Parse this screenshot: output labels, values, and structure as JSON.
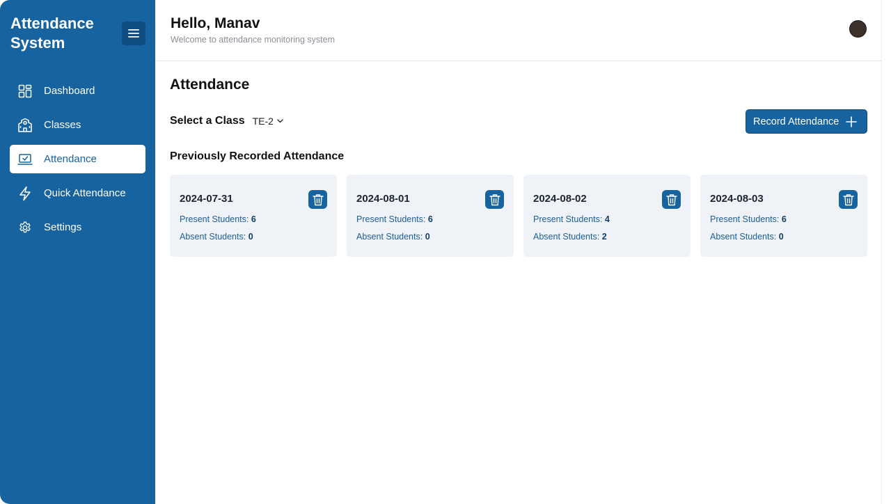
{
  "app": {
    "brand": "Attendance System"
  },
  "sidebar": {
    "items": [
      {
        "label": "Dashboard",
        "icon": "dashboard-grid-icon"
      },
      {
        "label": "Classes",
        "icon": "school-building-icon"
      },
      {
        "label": "Attendance",
        "icon": "attendance-laptop-check-icon",
        "active": true
      },
      {
        "label": "Quick Attendance",
        "icon": "lightning-icon"
      },
      {
        "label": "Settings",
        "icon": "gear-icon"
      }
    ]
  },
  "header": {
    "greeting": "Hello, Manav",
    "subtitle": "Welcome to attendance monitoring system"
  },
  "main": {
    "title": "Attendance",
    "select_label": "Select a Class",
    "selected_class": "TE-2",
    "record_button": "Record Attendance",
    "section_title": "Previously Recorded Attendance",
    "present_label": "Present Students: ",
    "absent_label": "Absent Students: ",
    "records": [
      {
        "date": "2024-07-31",
        "present": "6",
        "absent": "0"
      },
      {
        "date": "2024-08-01",
        "present": "6",
        "absent": "0"
      },
      {
        "date": "2024-08-02",
        "present": "4",
        "absent": "2"
      },
      {
        "date": "2024-08-03",
        "present": "6",
        "absent": "0"
      }
    ]
  },
  "colors": {
    "sidebar_bg": "#17639f",
    "accent": "#17639f",
    "card_bg": "#eff3f8"
  }
}
